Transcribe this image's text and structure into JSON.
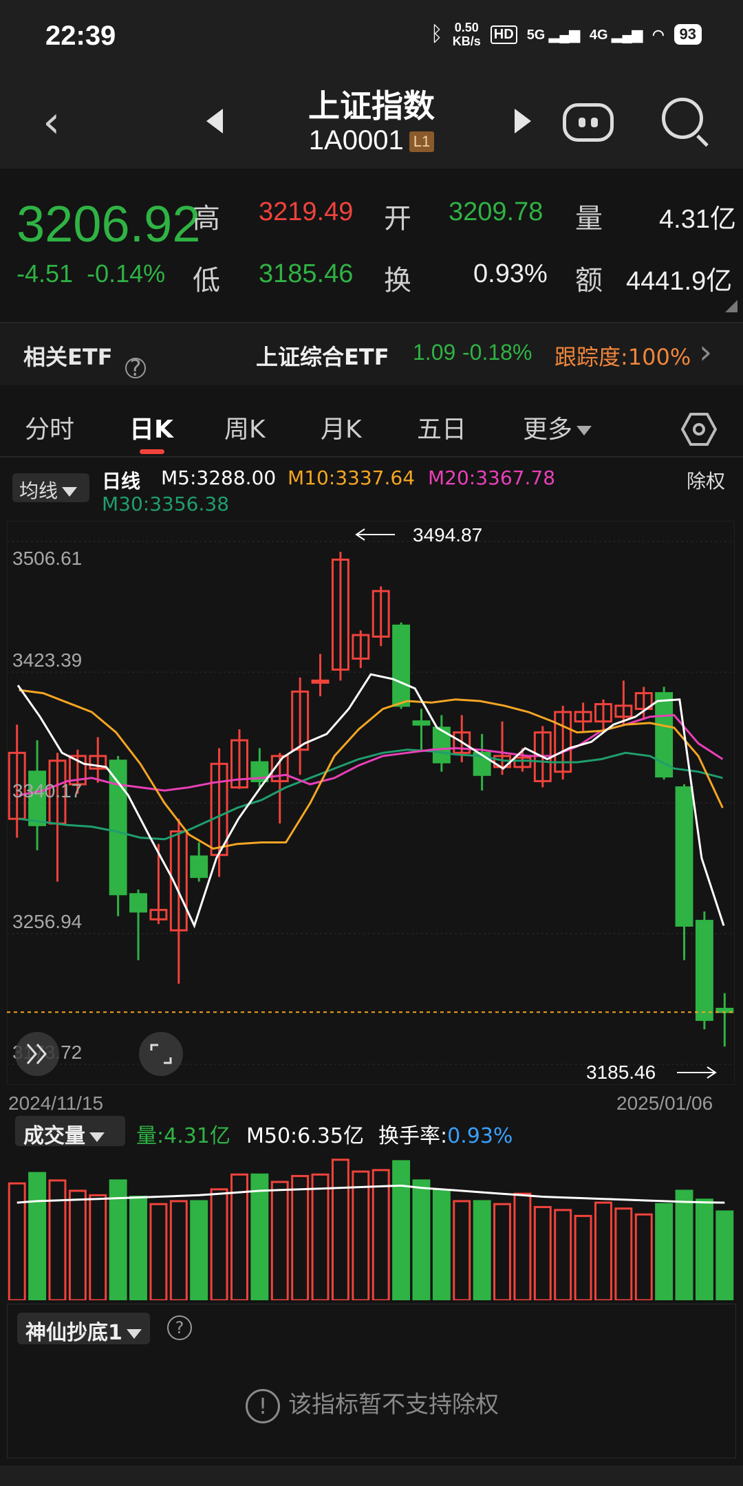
{
  "status": {
    "time": "22:39",
    "speed_value": "0.50",
    "speed_unit": "KB/s",
    "hd": "HD",
    "net1": "5G",
    "net2": "4G",
    "battery": "93"
  },
  "header": {
    "title": "上证指数",
    "code": "1A0001",
    "level": "L1"
  },
  "quote": {
    "price": "3206.92",
    "change": "-4.51",
    "change_pct": "-0.14%",
    "high_label": "高",
    "high": "3219.49",
    "low_label": "低",
    "low": "3185.46",
    "open_label": "开",
    "open": "3209.78",
    "turnover_label": "换",
    "turnover": "0.93%",
    "volume_label": "量",
    "volume": "4.31亿",
    "amount_label": "额",
    "amount": "4441.9亿"
  },
  "etf": {
    "label": "相关ETF",
    "help": "?",
    "name": "上证综合ETF",
    "price": "1.09",
    "pct": "-0.18%",
    "track": "跟踪度:100%",
    "arrow": "›"
  },
  "tabs": [
    "分时",
    "日K",
    "周K",
    "月K",
    "五日",
    "更多"
  ],
  "ma": {
    "selector": "均线",
    "period": "日线",
    "m5": "M5:3288.00",
    "m10": "M10:3337.64",
    "m20": "M20:3367.78",
    "m30": "M30:3356.38",
    "fuquan": "除权"
  },
  "colors": {
    "up": "#f0433b",
    "down": "#2fb344",
    "m5": "#ffffff",
    "m10": "#f5a623",
    "m20": "#e940b8",
    "m30": "#1f9e6e"
  },
  "chart_data": {
    "type": "candlestick",
    "y_ticks": [
      "3506.61",
      "3423.39",
      "3340.17",
      "3256.94",
      "3173.72"
    ],
    "ylim": [
      3173.72,
      3506.61
    ],
    "x_start": "2024/11/15",
    "x_end": "2025/01/06",
    "annot_high": "3494.87",
    "annot_low": "3185.46",
    "candles": [
      {
        "o": 3330,
        "c": 3372,
        "h": 3390,
        "l": 3318
      },
      {
        "o": 3360,
        "c": 3326,
        "h": 3380,
        "l": 3310
      },
      {
        "o": 3327,
        "c": 3367,
        "h": 3372,
        "l": 3290
      },
      {
        "o": 3352,
        "c": 3370,
        "h": 3374,
        "l": 3346
      },
      {
        "o": 3362,
        "c": 3370,
        "h": 3382,
        "l": 3353
      },
      {
        "o": 3367,
        "c": 3282,
        "h": 3370,
        "l": 3268
      },
      {
        "o": 3282,
        "c": 3271,
        "h": 3285,
        "l": 3240
      },
      {
        "o": 3266,
        "c": 3272,
        "h": 3314,
        "l": 3263
      },
      {
        "o": 3259,
        "c": 3322,
        "h": 3330,
        "l": 3225
      },
      {
        "o": 3306,
        "c": 3293,
        "h": 3315,
        "l": 3290
      },
      {
        "o": 3307,
        "c": 3365,
        "h": 3375,
        "l": 3293
      },
      {
        "o": 3350,
        "c": 3380,
        "h": 3387,
        "l": 3349
      },
      {
        "o": 3366,
        "c": 3354,
        "h": 3375,
        "l": 3350
      },
      {
        "o": 3354,
        "c": 3370,
        "h": 3372,
        "l": 3327
      },
      {
        "o": 3374,
        "c": 3411,
        "h": 3420,
        "l": 3358
      },
      {
        "o": 3418,
        "c": 3418,
        "h": 3435,
        "l": 3408
      },
      {
        "o": 3425,
        "c": 3495,
        "h": 3500,
        "l": 3418
      },
      {
        "o": 3432,
        "c": 3447,
        "h": 3450,
        "l": 3426
      },
      {
        "o": 3446,
        "c": 3475,
        "h": 3478,
        "l": 3440
      },
      {
        "o": 3453,
        "c": 3402,
        "h": 3455,
        "l": 3400
      },
      {
        "o": 3392,
        "c": 3390,
        "h": 3400,
        "l": 3374
      },
      {
        "o": 3388,
        "c": 3366,
        "h": 3396,
        "l": 3360
      },
      {
        "o": 3372,
        "c": 3385,
        "h": 3396,
        "l": 3366
      },
      {
        "o": 3372,
        "c": 3358,
        "h": 3384,
        "l": 3348
      },
      {
        "o": 3363,
        "c": 3370,
        "h": 3392,
        "l": 3358
      },
      {
        "o": 3363,
        "c": 3369,
        "h": 3375,
        "l": 3360
      },
      {
        "o": 3354,
        "c": 3385,
        "h": 3389,
        "l": 3350
      },
      {
        "o": 3360,
        "c": 3398,
        "h": 3402,
        "l": 3355
      },
      {
        "o": 3392,
        "c": 3398,
        "h": 3404,
        "l": 3386
      },
      {
        "o": 3392,
        "c": 3403,
        "h": 3406,
        "l": 3385
      },
      {
        "o": 3395,
        "c": 3402,
        "h": 3418,
        "l": 3389
      },
      {
        "o": 3400,
        "c": 3410,
        "h": 3414,
        "l": 3393
      },
      {
        "o": 3410,
        "c": 3357,
        "h": 3414,
        "l": 3355
      },
      {
        "o": 3350,
        "c": 3262,
        "h": 3352,
        "l": 3240
      },
      {
        "o": 3265,
        "c": 3202,
        "h": 3271,
        "l": 3196
      },
      {
        "o": 3209,
        "c": 3207,
        "h": 3219,
        "l": 3185
      }
    ],
    "ma5": [
      3415,
      3395,
      3372,
      3365,
      3363,
      3345,
      3318,
      3292,
      3262,
      3305,
      3330,
      3350,
      3369,
      3378,
      3384,
      3400,
      3422,
      3419,
      3413,
      3388,
      3380,
      3371,
      3362,
      3375,
      3368,
      3375,
      3379,
      3390,
      3395,
      3405,
      3406,
      3305,
      3262
    ],
    "ma10": [
      3412,
      3410,
      3404,
      3398,
      3385,
      3365,
      3340,
      3320,
      3311,
      3314,
      3315,
      3315,
      3340,
      3370,
      3387,
      3400,
      3405,
      3404,
      3406,
      3405,
      3402,
      3398,
      3392,
      3385,
      3386,
      3390,
      3391,
      3388,
      3370,
      3337
    ],
    "ma20": [
      3345,
      3348,
      3354,
      3356,
      3352,
      3350,
      3348,
      3350,
      3353,
      3355,
      3356,
      3358,
      3352,
      3356,
      3364,
      3370,
      3372,
      3374,
      3375,
      3374,
      3372,
      3370,
      3370,
      3376,
      3386,
      3390,
      3395,
      3396,
      3378,
      3368
    ],
    "ma30": [
      3330,
      3328,
      3326,
      3325,
      3322,
      3318,
      3317,
      3323,
      3330,
      3337,
      3342,
      3350,
      3356,
      3362,
      3368,
      3372,
      3374,
      3373,
      3371,
      3370,
      3367,
      3367,
      3366,
      3366,
      3368,
      3372,
      3370,
      3362,
      3360,
      3356
    ]
  },
  "volume": {
    "selector": "成交量",
    "vol": "量:4.31亿",
    "m50": "M50:6.35亿",
    "turnover_label": "换手率:",
    "turnover": "0.93%",
    "values": [
      7.9,
      8.6,
      8.1,
      7.4,
      7.1,
      8.1,
      7.0,
      6.5,
      6.7,
      6.7,
      7.5,
      8.5,
      8.5,
      8.0,
      8.4,
      8.5,
      9.5,
      8.7,
      8.8,
      9.4,
      8.1,
      7.4,
      6.7,
      6.7,
      6.5,
      7.2,
      6.3,
      6.1,
      5.7,
      6.6,
      6.2,
      5.8,
      6.5,
      7.4,
      6.8,
      6.0
    ],
    "ma": [
      6.6,
      6.7,
      6.75,
      6.8,
      6.85,
      6.9,
      6.95,
      7.0,
      7.05,
      7.1,
      7.2,
      7.3,
      7.4,
      7.45,
      7.5,
      7.55,
      7.6,
      7.65,
      7.7,
      7.75,
      7.6,
      7.5,
      7.4,
      7.3,
      7.2,
      7.1,
      7.0,
      6.95,
      6.9,
      6.85,
      6.8,
      6.75,
      6.7,
      6.65,
      6.62,
      6.6
    ]
  },
  "indicator": {
    "selector": "神仙抄底1",
    "help": "?",
    "notice": "该指标暂不支持除权",
    "excl": "!"
  }
}
